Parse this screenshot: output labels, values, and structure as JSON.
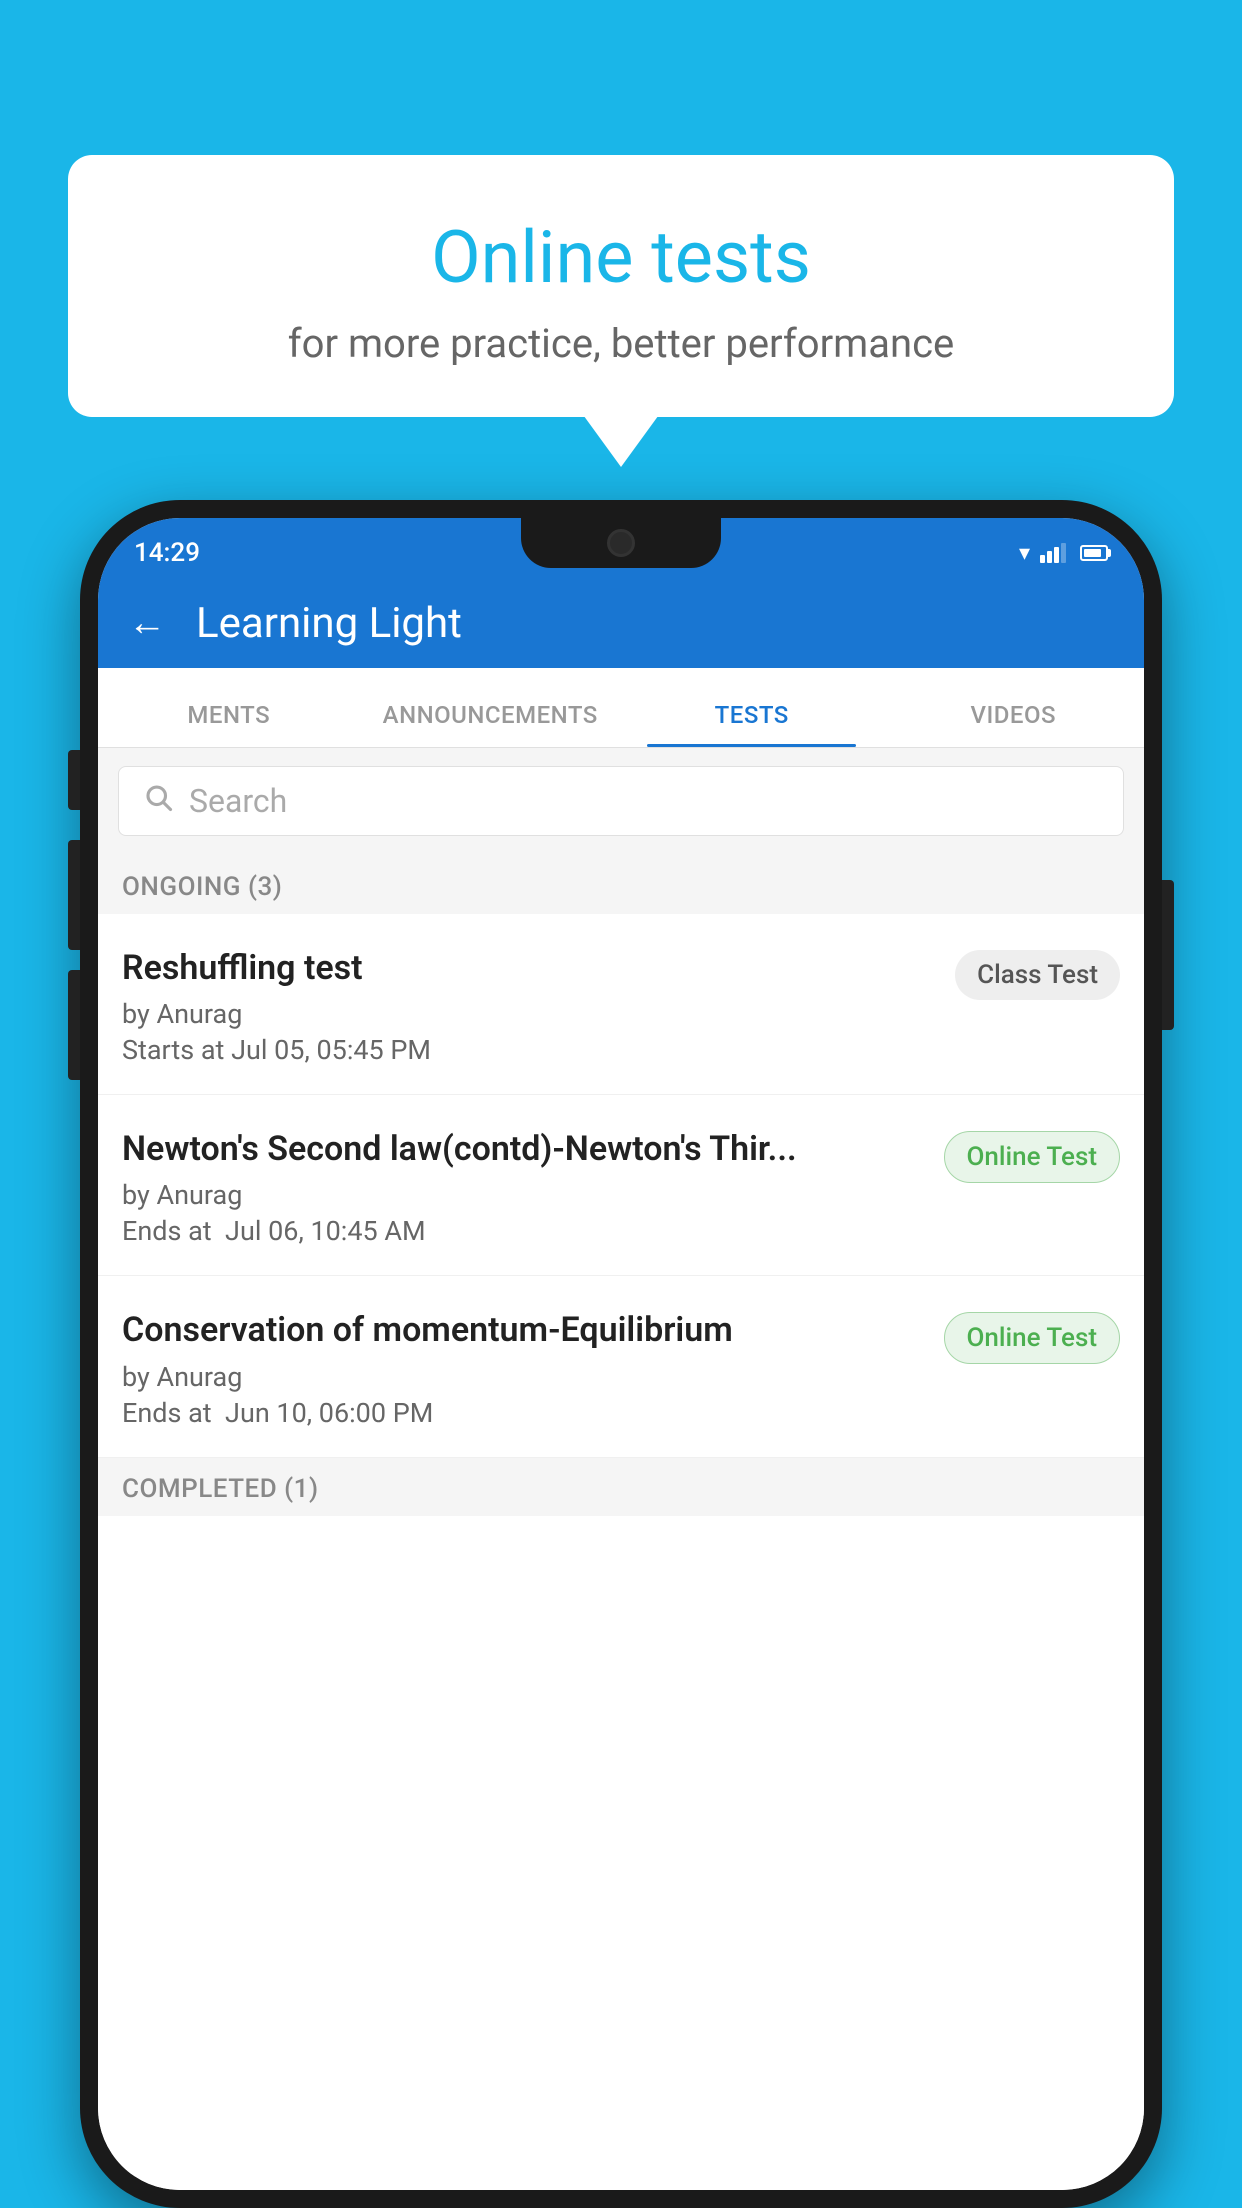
{
  "background_color": "#1ab6e8",
  "bubble": {
    "title": "Online tests",
    "subtitle": "for more practice, better performance"
  },
  "phone": {
    "status_bar": {
      "time": "14:29",
      "wifi": "▾",
      "signal": "▲",
      "battery_label": "battery"
    },
    "header": {
      "back_label": "←",
      "title": "Learning Light"
    },
    "tabs": [
      {
        "label": "MENTS",
        "active": false
      },
      {
        "label": "ANNOUNCEMENTS",
        "active": false
      },
      {
        "label": "TESTS",
        "active": true
      },
      {
        "label": "VIDEOS",
        "active": false
      }
    ],
    "search": {
      "placeholder": "Search"
    },
    "ongoing_section": {
      "label": "ONGOING (3)"
    },
    "tests": [
      {
        "name": "Reshuffling test",
        "author": "by Anurag",
        "time_label": "Starts at",
        "time_value": "Jul 05, 05:45 PM",
        "badge": "Class Test",
        "badge_type": "class"
      },
      {
        "name": "Newton's Second law(contd)-Newton's Thir...",
        "author": "by Anurag",
        "time_label": "Ends at",
        "time_value": "Jul 06, 10:45 AM",
        "badge": "Online Test",
        "badge_type": "online"
      },
      {
        "name": "Conservation of momentum-Equilibrium",
        "author": "by Anurag",
        "time_label": "Ends at",
        "time_value": "Jun 10, 06:00 PM",
        "badge": "Online Test",
        "badge_type": "online"
      }
    ],
    "completed_section": {
      "label": "COMPLETED (1)"
    }
  }
}
